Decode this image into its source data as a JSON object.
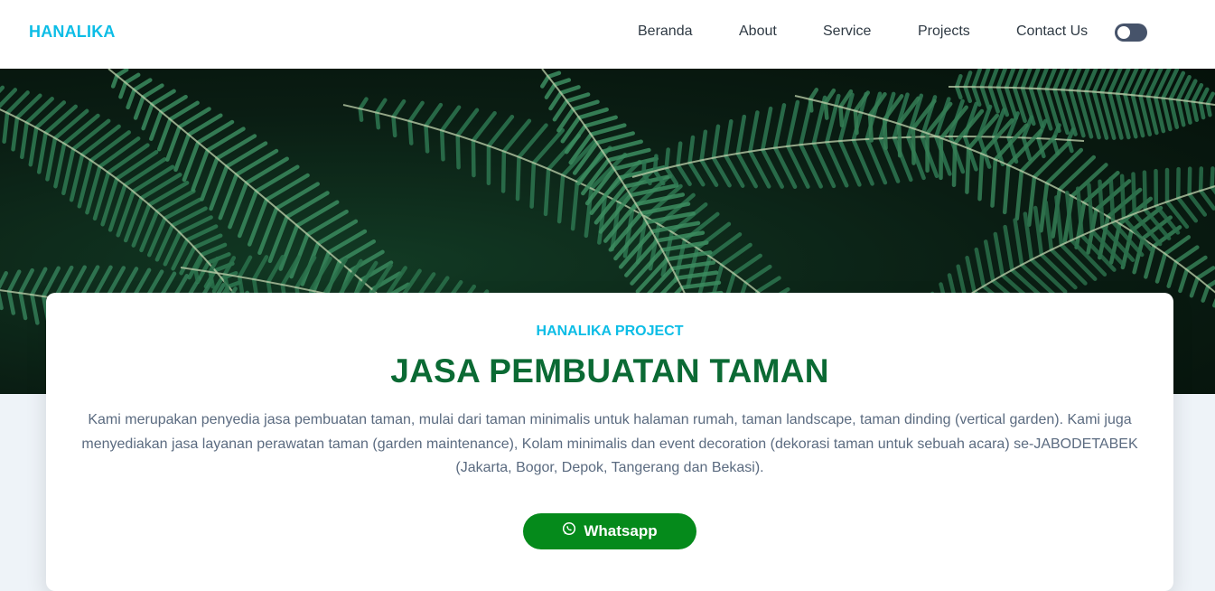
{
  "brand": {
    "name": "HANALIKA"
  },
  "nav": {
    "items": [
      {
        "label": "Beranda"
      },
      {
        "label": "About"
      },
      {
        "label": "Service"
      },
      {
        "label": "Projects"
      },
      {
        "label": "Contact Us"
      }
    ],
    "theme_toggle": {
      "state": "off"
    }
  },
  "hero": {
    "image": "fern-leaves-photo"
  },
  "card": {
    "eyebrow": "HANALIKA PROJECT",
    "title": "JASA PEMBUATAN TAMAN",
    "description": "Kami merupakan penyedia jasa pembuatan taman, mulai dari taman minimalis untuk halaman rumah, taman landscape, taman dinding (vertical garden). Kami juga menyediakan jasa layanan perawatan taman (garden maintenance), Kolam minimalis dan event decoration (dekorasi taman untuk sebuah acara) se-JABODETABEK (Jakarta, Bogor, Depok, Tangerang dan Bekasi).",
    "cta": {
      "label": "Whatsapp",
      "icon": "whatsapp-icon"
    }
  },
  "colors": {
    "brand": "#0cbde6",
    "title": "#0b6a34",
    "cta": "#058a1b",
    "text": "#5b6b80",
    "page_bg": "#eef3f8"
  }
}
